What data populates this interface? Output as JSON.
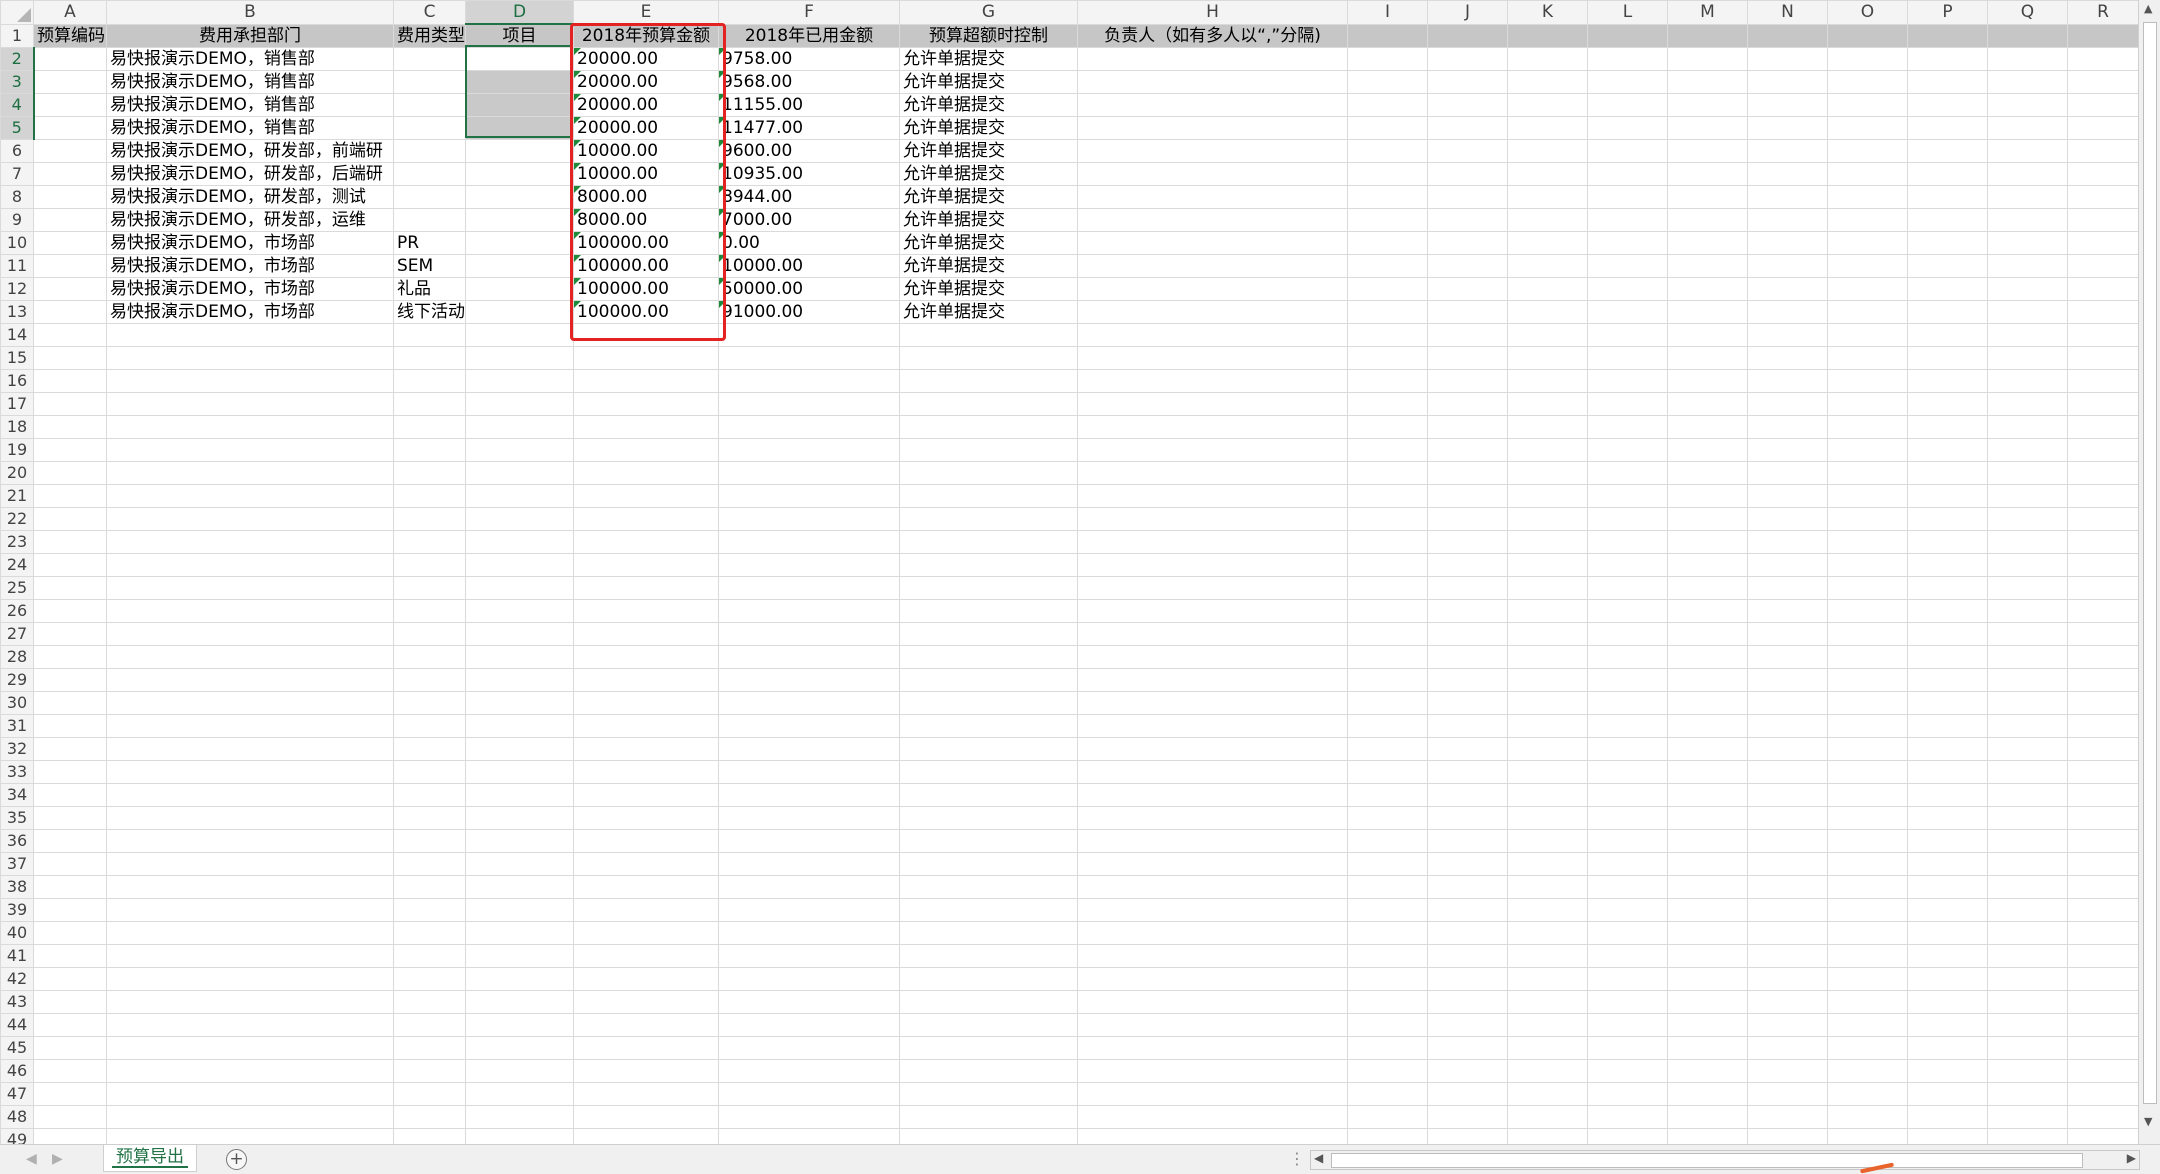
{
  "columns": [
    "A",
    "B",
    "C",
    "D",
    "E",
    "F",
    "G",
    "H",
    "I",
    "J",
    "K",
    "L",
    "M",
    "N",
    "O",
    "P",
    "Q",
    "R"
  ],
  "active_column": "D",
  "active_rows": [
    2,
    3,
    4,
    5
  ],
  "header": [
    "预算编码",
    "费用承担部门",
    "费用类型",
    "项目",
    "2018年预算金额",
    "2018年已用金额",
    "预算超额时控制",
    "负责人（如有多人以“,”分隔)"
  ],
  "rows": [
    {
      "b": "易快报演示DEMO，销售部",
      "c": "",
      "e": "20000.00",
      "f": "9758.00",
      "g": "允许单据提交"
    },
    {
      "b": "易快报演示DEMO，销售部",
      "c": "",
      "e": "20000.00",
      "f": "9568.00",
      "g": "允许单据提交"
    },
    {
      "b": "易快报演示DEMO，销售部",
      "c": "",
      "e": "20000.00",
      "f": "11155.00",
      "g": "允许单据提交"
    },
    {
      "b": "易快报演示DEMO，销售部",
      "c": "",
      "e": "20000.00",
      "f": "11477.00",
      "g": "允许单据提交"
    },
    {
      "b": "易快报演示DEMO，研发部，前端研",
      "c": "",
      "e": "10000.00",
      "f": "9600.00",
      "g": "允许单据提交"
    },
    {
      "b": "易快报演示DEMO，研发部，后端研",
      "c": "",
      "e": "10000.00",
      "f": "10935.00",
      "g": "允许单据提交"
    },
    {
      "b": "易快报演示DEMO，研发部，测试",
      "c": "",
      "e": "8000.00",
      "f": "8944.00",
      "g": "允许单据提交"
    },
    {
      "b": "易快报演示DEMO，研发部，运维",
      "c": "",
      "e": "8000.00",
      "f": "7000.00",
      "g": "允许单据提交"
    },
    {
      "b": "易快报演示DEMO，市场部",
      "c": "PR",
      "e": "100000.00",
      "f": "0.00",
      "g": "允许单据提交"
    },
    {
      "b": "易快报演示DEMO，市场部",
      "c": "SEM",
      "e": "100000.00",
      "f": "10000.00",
      "g": "允许单据提交"
    },
    {
      "b": "易快报演示DEMO，市场部",
      "c": "礼品",
      "e": "100000.00",
      "f": "50000.00",
      "g": "允许单据提交"
    },
    {
      "b": "易快报演示DEMO，市场部",
      "c": "线下活动",
      "e": "100000.00",
      "f": "91000.00",
      "g": "允许单据提交"
    }
  ],
  "total_rows": 49,
  "sheet_tab": "预算导出",
  "icons": {
    "add_sheet": "plus-circle-icon",
    "select_all": "select-all-triangle-icon"
  },
  "colors": {
    "accent": "#217346",
    "highlight_box": "#e42222",
    "header_fill": "#c6c6c6"
  }
}
